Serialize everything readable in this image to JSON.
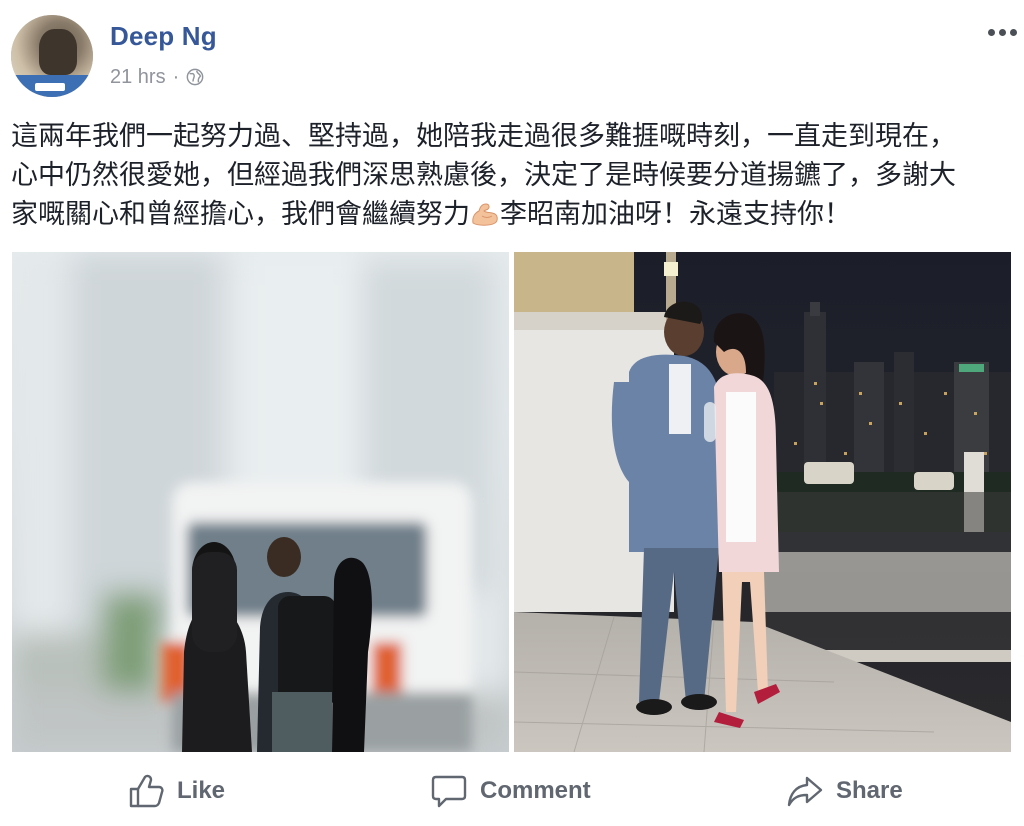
{
  "post": {
    "author": "Deep Ng",
    "time": "21 hrs",
    "separator": "·",
    "text_lines": [
      "這兩年我們一起努力過、堅持過，她陪我走過很多難捱嘅時刻，一直走到現在，",
      "心中仍然很愛她，但經過我們深思熟慮後，決定了是時候要分道揚鑣了，多謝大",
      "家嘅關心和曾經擔心，我們會繼續努力"
    ],
    "text_line3_after_emoji": "李昭南加油呀！永遠支持你！",
    "emoji": "flexed-biceps",
    "privacy_icon": "globe-icon"
  },
  "actions": {
    "like": "Like",
    "comment": "Comment",
    "share": "Share"
  }
}
